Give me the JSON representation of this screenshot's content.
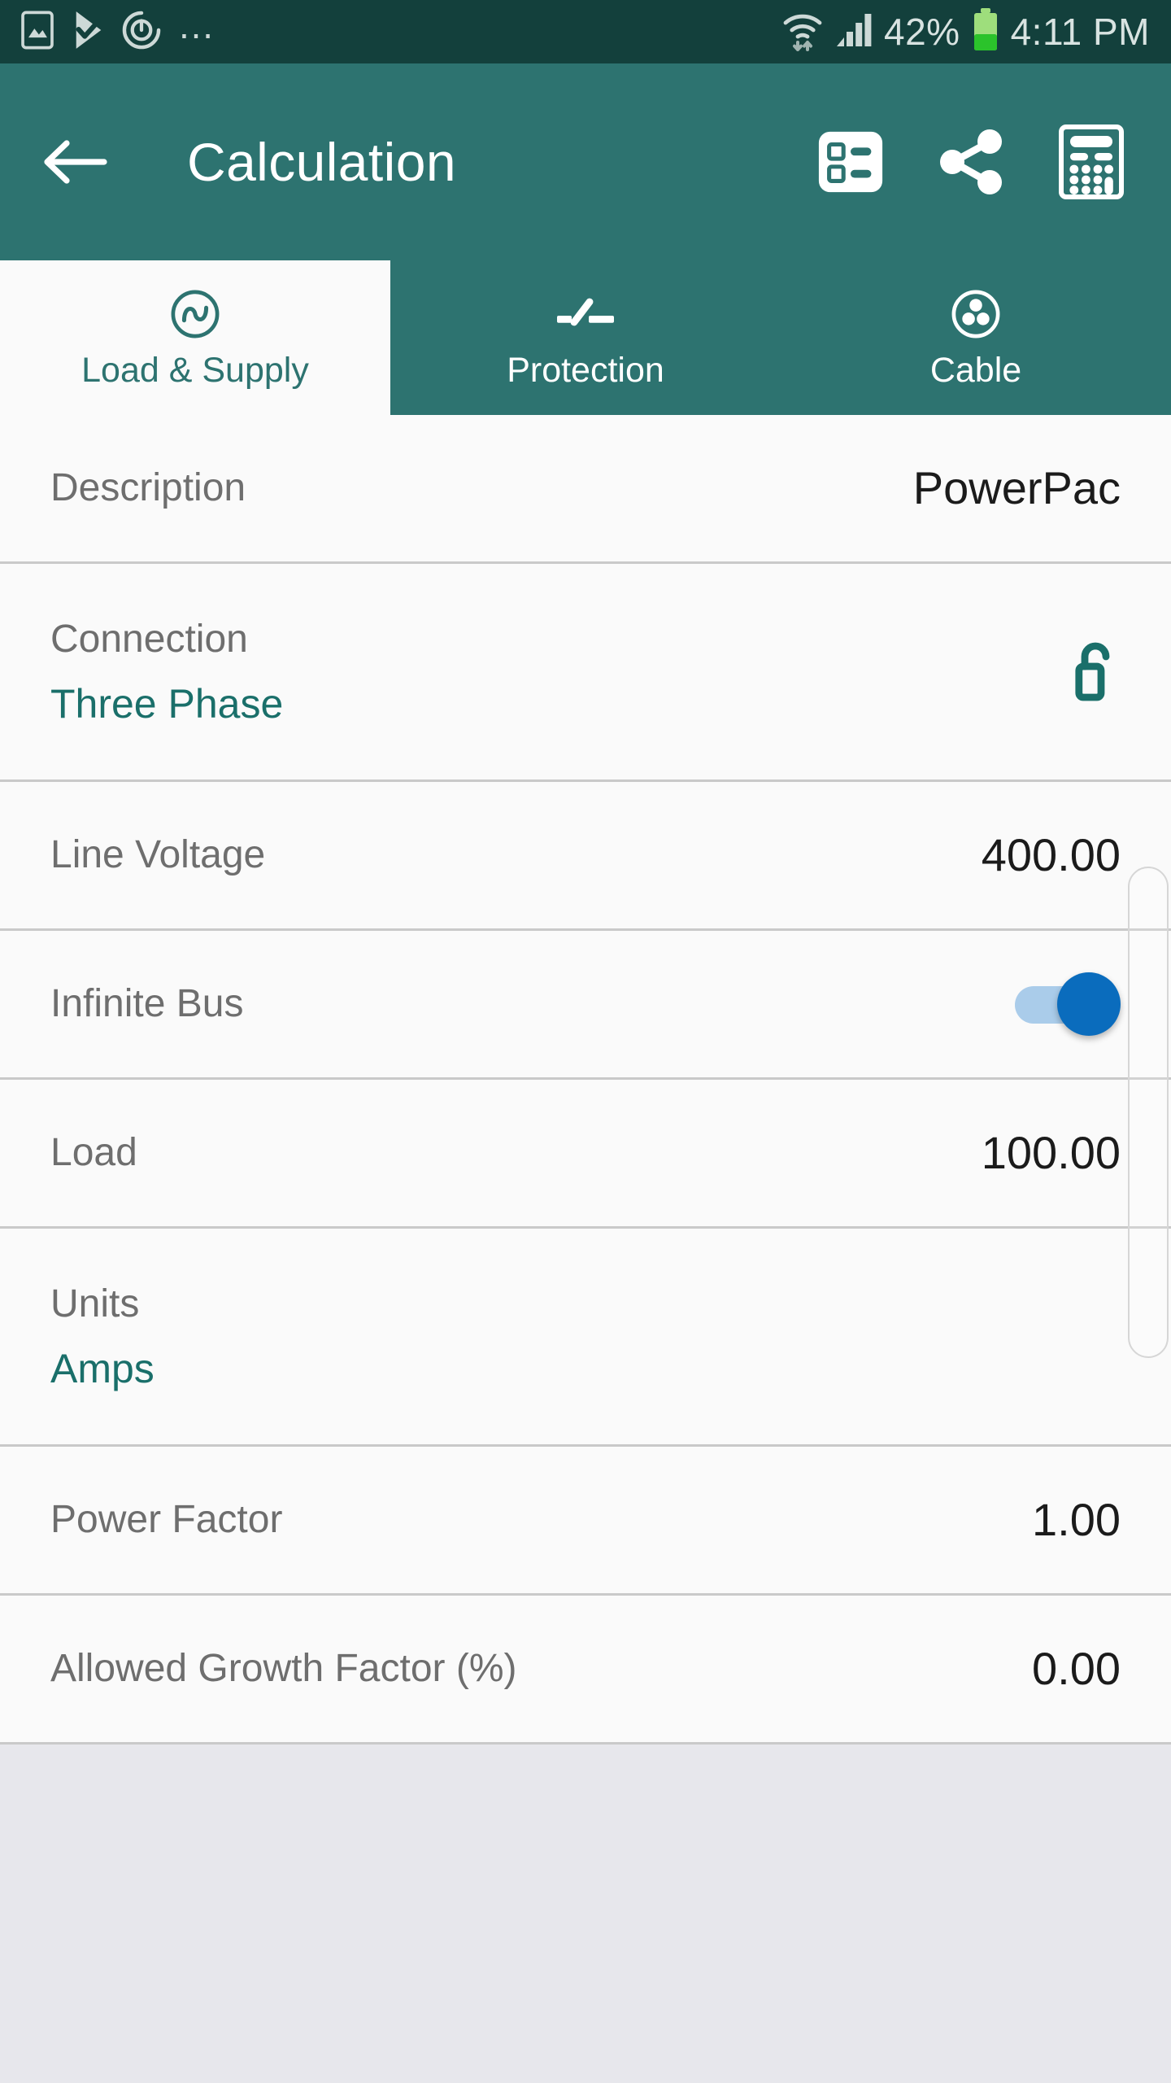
{
  "status_bar": {
    "left_icons": [
      "screenshot-icon",
      "play-update-icon",
      "power-sync-icon",
      "overflow-dots-icon"
    ],
    "overflow_dots": "…",
    "battery_percent": "42%",
    "time": "4:11 PM",
    "background_color": "#13403c",
    "text_color": "#d8e3e1"
  },
  "app_bar": {
    "back_icon": "arrow-left-icon",
    "title": "Calculation",
    "actions": [
      {
        "name": "summary-icon",
        "label": "Summary"
      },
      {
        "name": "share-icon",
        "label": "Share"
      },
      {
        "name": "calculator-icon",
        "label": "Calculator"
      }
    ],
    "background_color": "#2d7370",
    "title_color": "#ffffff"
  },
  "tabs": {
    "active_index": 0,
    "items": [
      {
        "label": "Load & Supply",
        "icon": "ac-waveform-circle-icon"
      },
      {
        "label": "Protection",
        "icon": "circuit-breaker-icon"
      },
      {
        "label": "Cable",
        "icon": "cable-cores-circle-icon"
      }
    ],
    "active_background": "#fafafa",
    "active_text_color": "#2d7370",
    "inactive_text_color": "#ffffff"
  },
  "form": {
    "rows": [
      {
        "type": "value",
        "label": "Description",
        "value": "PowerPac"
      },
      {
        "type": "stacked-lock",
        "label": "Connection",
        "sub_value": "Three Phase",
        "icon": "unlock-icon"
      },
      {
        "type": "value",
        "label": "Line Voltage",
        "value": "400.00"
      },
      {
        "type": "toggle",
        "label": "Infinite Bus",
        "toggle_on": true
      },
      {
        "type": "value",
        "label": "Load",
        "value": "100.00"
      },
      {
        "type": "stacked",
        "label": "Units",
        "sub_value": "Amps"
      },
      {
        "type": "value",
        "label": "Power Factor",
        "value": "1.00"
      },
      {
        "type": "value",
        "label": "Allowed Growth Factor (%)",
        "value": "0.00"
      }
    ],
    "label_color": "#6e6e6e",
    "value_color": "#1b1b1b",
    "accent_color": "#1a6f6a",
    "row_background": "#fafafa",
    "divider_color": "#c9c9c9",
    "empty_area_color": "#e7e7ec"
  }
}
